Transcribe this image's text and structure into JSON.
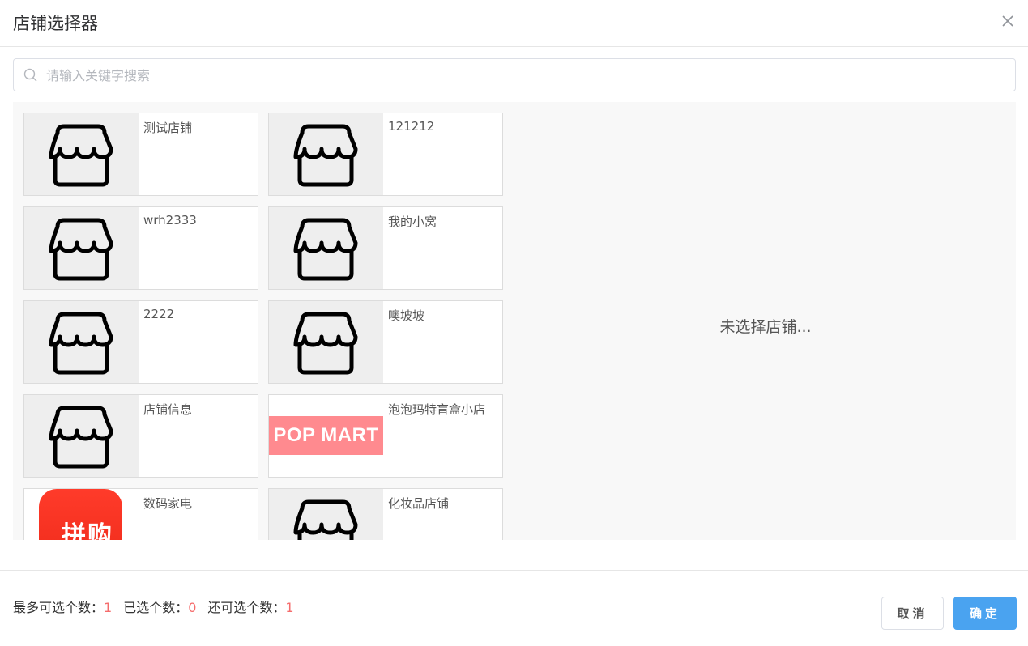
{
  "dialog": {
    "title": "店铺选择器",
    "close_icon": "close-icon"
  },
  "search": {
    "placeholder": "请输入关键字搜索",
    "value": "",
    "icon": "search-icon"
  },
  "stores": [
    {
      "name": "测试店铺",
      "thumb": "shop-icon"
    },
    {
      "name": "121212",
      "thumb": "shop-icon"
    },
    {
      "name": "wrh2333",
      "thumb": "shop-icon"
    },
    {
      "name": "我的小窝",
      "thumb": "shop-icon"
    },
    {
      "name": "2222",
      "thumb": "shop-icon"
    },
    {
      "name": "噢坡坡",
      "thumb": "shop-icon"
    },
    {
      "name": "店铺信息",
      "thumb": "shop-icon"
    },
    {
      "name": "泡泡玛特盲盒小店",
      "thumb": "popmart-logo",
      "logo_text": "POP MART"
    },
    {
      "name": "数码家电",
      "thumb": "pinduoduo-logo",
      "logo_text": "拼购"
    },
    {
      "name": "化妆品店铺",
      "thumb": "shop-icon"
    }
  ],
  "selected_panel": {
    "empty_text": "未选择店铺..."
  },
  "footer": {
    "max_label": "最多可选个数：",
    "max_value": "1",
    "selected_label": "已选个数：",
    "selected_value": "0",
    "remaining_label": "还可选个数：",
    "remaining_value": "1",
    "cancel_label": "取消",
    "confirm_label": "确定"
  },
  "colors": {
    "primary": "#4aa3f0",
    "count": "#f56c6c",
    "popmart": "#ff8a8f",
    "pinduoduo": "#ee2a1a"
  }
}
